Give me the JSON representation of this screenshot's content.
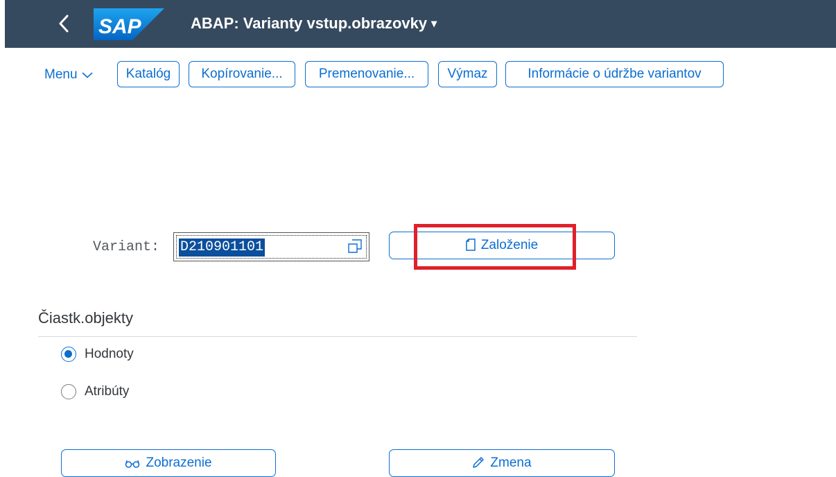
{
  "shell": {
    "back_icon": "chevron-left-icon",
    "logo_text": "SAP",
    "title": "ABAP: Varianty vstup.obrazovky",
    "title_caret": "▾",
    "colors": {
      "shellbar": "#354a5f",
      "accent": "#0a6ed1",
      "highlight": "#e0202a"
    }
  },
  "toolbar": {
    "menu_label": "Menu",
    "catalog": "Katalóg",
    "copy": "Kopírovanie...",
    "rename": "Premenovanie...",
    "delete": "Výmaz",
    "info": "Informácie o údržbe variantov"
  },
  "form": {
    "variant_label": "Variant:",
    "variant_value": "D210901101",
    "create_label": "Založenie"
  },
  "subobjects": {
    "title": "Čiastk.objekty",
    "options": [
      {
        "label": "Hodnoty",
        "checked": true
      },
      {
        "label": "Atribúty",
        "checked": false
      }
    ]
  },
  "actions": {
    "display_label": "Zobrazenie",
    "change_label": "Zmena"
  }
}
